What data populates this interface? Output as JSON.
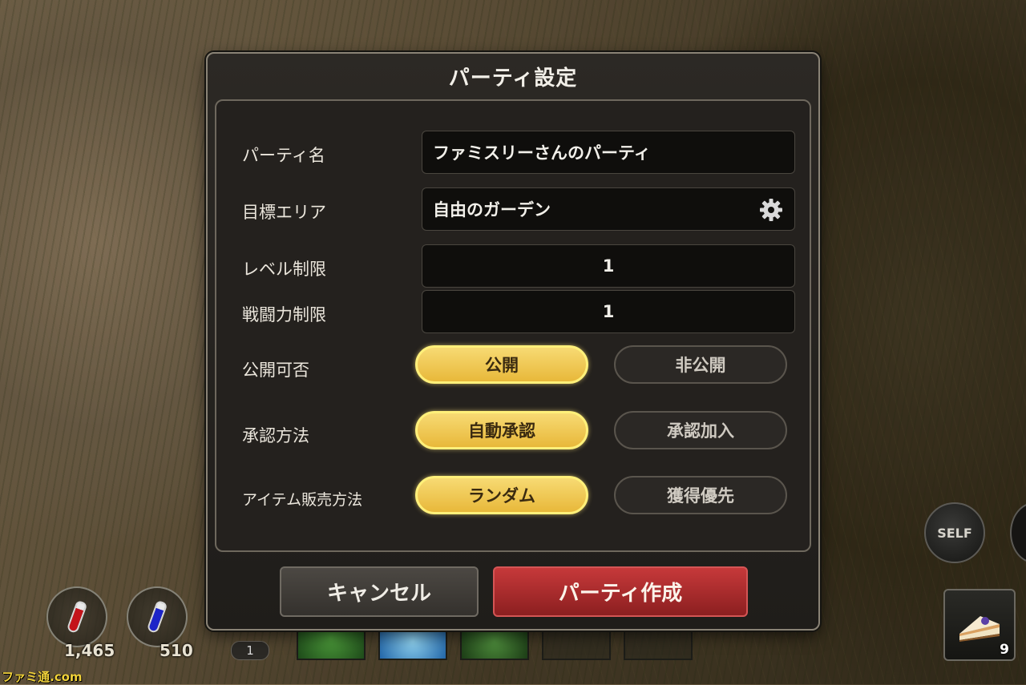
{
  "dialog": {
    "title": "パーティ設定",
    "fields": {
      "party_name_label": "パーティ名",
      "party_name_value": "ファミスリーさんのパーティ",
      "target_area_label": "目標エリア",
      "target_area_value": "自由のガーデン",
      "level_limit_label": "レベル制限",
      "level_limit_value": "1",
      "power_limit_label": "戦闘力制限",
      "power_limit_value": "1"
    },
    "options": {
      "visibility_label": "公開可否",
      "visibility_choices": [
        "公開",
        "非公開"
      ],
      "visibility_selected": "公開",
      "approval_label": "承認方法",
      "approval_choices": [
        "自動承認",
        "承認加入"
      ],
      "approval_selected": "自動承認",
      "item_sale_label": "アイテム販売方法",
      "item_sale_choices": [
        "ランダム",
        "獲得優先"
      ],
      "item_sale_selected": "ランダム"
    },
    "buttons": {
      "cancel": "キャンセル",
      "create": "パーティ作成"
    }
  },
  "hud": {
    "hp_potion_count": "1,465",
    "mp_potion_count": "510",
    "skill_slot_number": "1",
    "self_button": "SELF",
    "item_count": "9"
  },
  "watermark": "ファミ通.com",
  "colors": {
    "selected_option": "#f2c94c",
    "create_button": "#b02a2b",
    "dialog_bg": "#24211e"
  }
}
